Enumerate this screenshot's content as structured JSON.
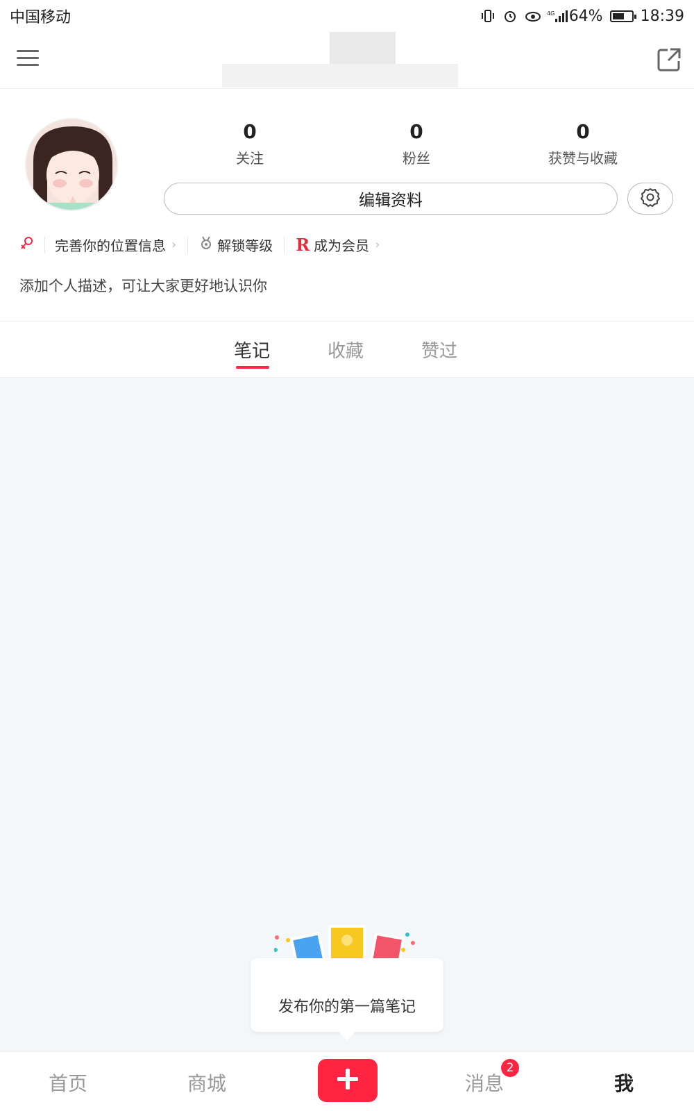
{
  "status_bar": {
    "carrier": "中国移动",
    "battery": "64%",
    "battery_level": 0.64,
    "time": "18:39",
    "network": "4G"
  },
  "profile": {
    "stats": [
      {
        "value": "0",
        "label": "关注"
      },
      {
        "value": "0",
        "label": "粉丝"
      },
      {
        "value": "0",
        "label": "获赞与收藏"
      }
    ],
    "edit_label": "编辑资料",
    "info_items": [
      {
        "icon": "location-pin-icon",
        "label": "完善你的位置信息"
      },
      {
        "icon": "medal-icon",
        "label": "解锁等级"
      },
      {
        "icon": "r-member-icon",
        "label": "成为会员"
      }
    ],
    "bio_placeholder": "添加个人描述，可让大家更好地认识你"
  },
  "tabs": [
    {
      "label": "笔记",
      "active": true
    },
    {
      "label": "收藏",
      "active": false
    },
    {
      "label": "赞过",
      "active": false
    }
  ],
  "empty_state": {
    "tooltip": "发布你的第一篇笔记"
  },
  "bottom_nav": {
    "items": [
      {
        "label": "首页",
        "active": false
      },
      {
        "label": "商城",
        "active": false
      },
      {
        "label": "消息",
        "active": false
      },
      {
        "label": "我",
        "active": true
      }
    ],
    "messages_badge": "2"
  },
  "colors": {
    "accent": "#ff2442",
    "background": "#f4f7fa"
  }
}
